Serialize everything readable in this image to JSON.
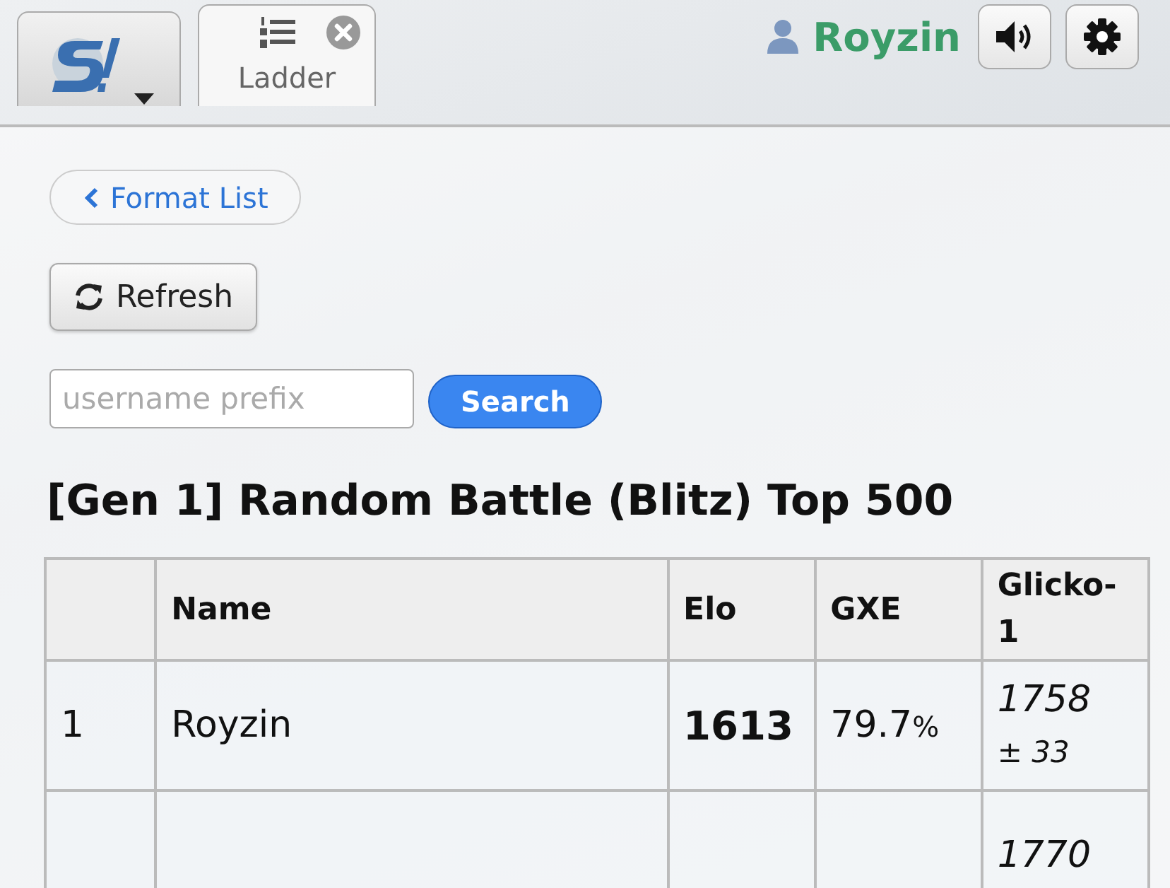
{
  "header": {
    "tabs": [
      {
        "kind": "home",
        "selected": false
      },
      {
        "kind": "ladder",
        "label": "Ladder",
        "selected": true
      }
    ],
    "username": "Royzin"
  },
  "nav": {
    "back_button": "Format List",
    "refresh_button": "Refresh",
    "search": {
      "placeholder": "username prefix",
      "button": "Search"
    }
  },
  "title": "[Gen 1] Random Battle (Blitz) Top 500",
  "table": {
    "columns": [
      "",
      "Name",
      "Elo",
      "GXE",
      "Glicko-1"
    ],
    "rows": [
      {
        "rank": "1",
        "name": "Royzin",
        "elo": "1613",
        "gxe": "79.7",
        "gxe_unit": "%",
        "glicko": "1758",
        "deviation": "± 33"
      },
      {
        "rank": "",
        "name": "",
        "elo": "",
        "gxe": "",
        "gxe_unit": "",
        "glicko": "1770",
        "deviation": ""
      }
    ]
  }
}
